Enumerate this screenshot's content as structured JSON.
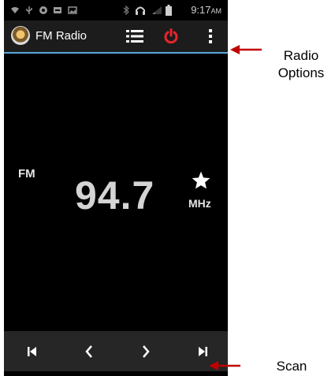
{
  "status_bar": {
    "time": "9:17",
    "ampm": "AM",
    "icons": [
      "wifi-icon",
      "usb-icon",
      "sync-icon",
      "notification-icon",
      "image-icon",
      "bluetooth-icon",
      "headset-icon",
      "signal-icon",
      "battery-icon"
    ]
  },
  "action_bar": {
    "title": "FM Radio",
    "icons": [
      "radio-logo-icon",
      "list-icon",
      "power-icon",
      "overflow-menu-icon"
    ],
    "accent_color": "#5aa8d8",
    "power_color": "#e8262b"
  },
  "tuner": {
    "band": "FM",
    "frequency": "94.7",
    "unit": "MHz",
    "favorite_icon": "star-icon"
  },
  "controls": {
    "icons": [
      "skip-previous-icon",
      "seek-back-icon",
      "seek-forward-icon",
      "skip-next-icon"
    ]
  },
  "annotations": {
    "radio_options_line1": "Radio",
    "radio_options_line2": "Options",
    "scan": "Scan",
    "arrow_color": "#c00000"
  }
}
